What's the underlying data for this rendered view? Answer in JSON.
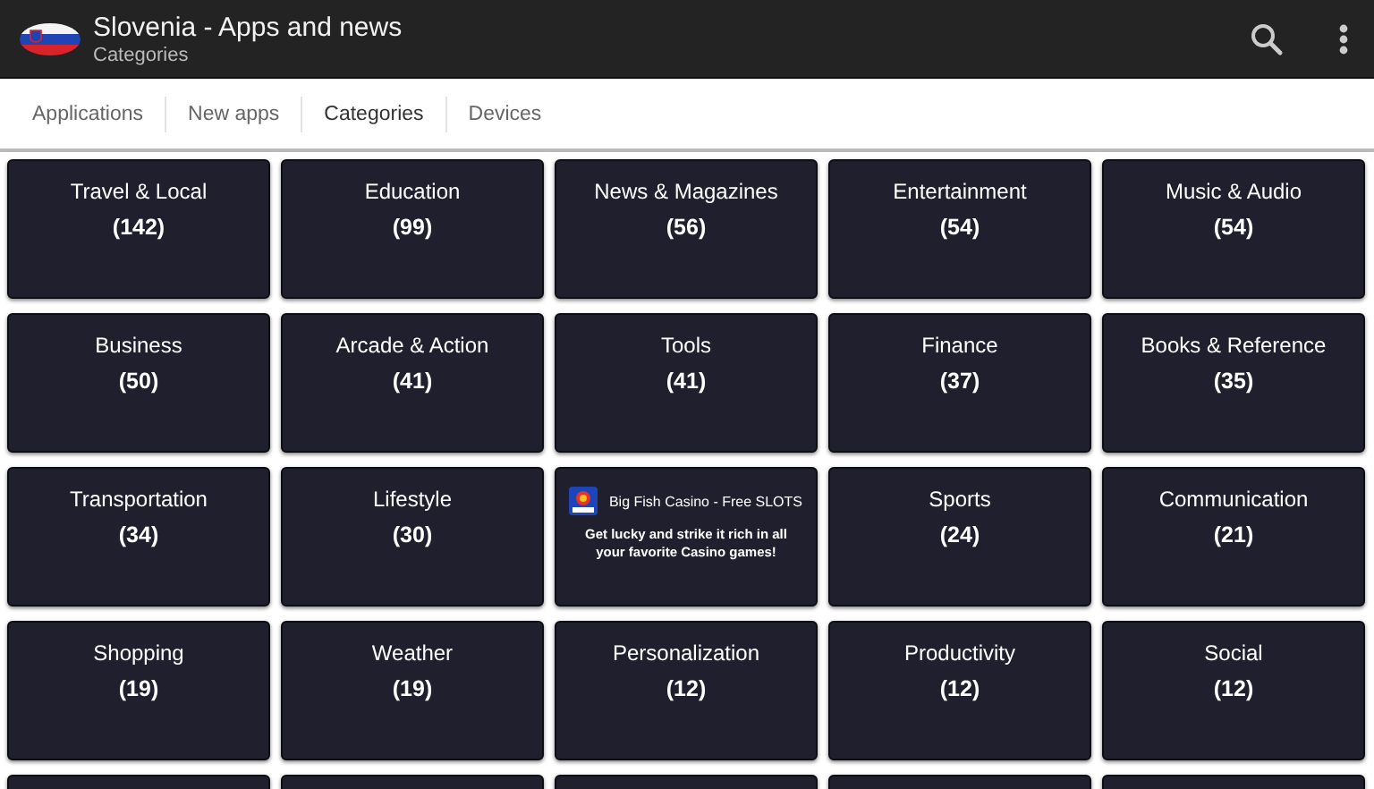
{
  "app_bar": {
    "title": "Slovenia - Apps and news",
    "subtitle": "Categories"
  },
  "tabs": [
    {
      "label": "Applications",
      "selected": false
    },
    {
      "label": "New apps",
      "selected": false
    },
    {
      "label": "Categories",
      "selected": true
    },
    {
      "label": "Devices",
      "selected": false
    }
  ],
  "tiles": [
    {
      "kind": "category",
      "name": "Travel & Local",
      "count": "(142)"
    },
    {
      "kind": "category",
      "name": "Education",
      "count": "(99)"
    },
    {
      "kind": "category",
      "name": "News & Magazines",
      "count": "(56)"
    },
    {
      "kind": "category",
      "name": "Entertainment",
      "count": "(54)"
    },
    {
      "kind": "category",
      "name": "Music & Audio",
      "count": "(54)"
    },
    {
      "kind": "category",
      "name": "Business",
      "count": "(50)"
    },
    {
      "kind": "category",
      "name": "Arcade & Action",
      "count": "(41)"
    },
    {
      "kind": "category",
      "name": "Tools",
      "count": "(41)"
    },
    {
      "kind": "category",
      "name": "Finance",
      "count": "(37)"
    },
    {
      "kind": "category",
      "name": "Books & Reference",
      "count": "(35)"
    },
    {
      "kind": "category",
      "name": "Transportation",
      "count": "(34)"
    },
    {
      "kind": "category",
      "name": "Lifestyle",
      "count": "(30)"
    },
    {
      "kind": "ad",
      "name": "Big Fish Casino - Free SLOTS",
      "text": "Get lucky and strike it rich in all your favorite Casino games!"
    },
    {
      "kind": "category",
      "name": "Sports",
      "count": "(24)"
    },
    {
      "kind": "category",
      "name": "Communication",
      "count": "(21)"
    },
    {
      "kind": "category",
      "name": "Shopping",
      "count": "(19)"
    },
    {
      "kind": "category",
      "name": "Weather",
      "count": "(19)"
    },
    {
      "kind": "category",
      "name": "Personalization",
      "count": "(12)"
    },
    {
      "kind": "category",
      "name": "Productivity",
      "count": "(12)"
    },
    {
      "kind": "category",
      "name": "Social",
      "count": "(12)"
    }
  ]
}
